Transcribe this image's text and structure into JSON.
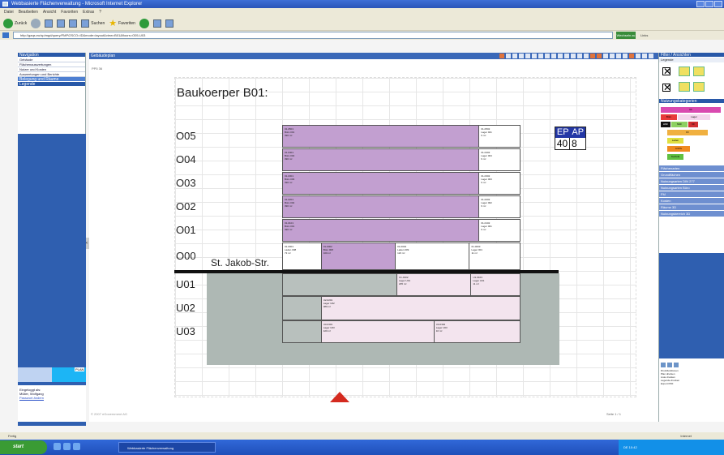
{
  "browser": {
    "title": "Webbasierte Flächenverwaltung - Microsoft Internet Explorer",
    "menu": [
      "Datei",
      "Bearbeiten",
      "Ansicht",
      "Favoriten",
      "Extras",
      "?"
    ],
    "back_label": "Zurück",
    "search_label": "Suchen",
    "favorites_label": "Favoriten",
    "address": "http://gaqs.eu/sp/mgd/query/FMP/2SCO=ID&mode=layout&view=B01&floors=O05-U03",
    "go_label": "Wechseln zu",
    "links_label": "Links"
  },
  "left_panel": {
    "header": "Navigation",
    "items": [
      "Gebäude",
      "Flächenauswertungen",
      "Nutzer und Kosten",
      "Auswertungen und Berichte",
      "Belegung und Räume",
      "Legende"
    ],
    "login_title": "Eingeloggt als:",
    "login_user": "Müller, Wolfgang",
    "login_link": "Passwort ändern",
    "mini_label": "PLAN"
  },
  "main": {
    "header": "Gebäudeplan",
    "sheet_id": "PP5 36",
    "building_title": "Baukoerper B01:",
    "street": "St. Jakob-Str.",
    "legend": {
      "ep": "EP",
      "ap": "AP",
      "ep_value": "40",
      "ap_value": "8"
    },
    "floors": [
      {
        "id": "O05",
        "cells": [
          {
            "kind": "office",
            "lines": [
              "01-0501",
              "Büro 001",
              "390 m²"
            ]
          },
          {
            "kind": "store",
            "lines": [
              "01-0502",
              "Lager 021",
              "9 m²"
            ]
          }
        ]
      },
      {
        "id": "O04",
        "cells": [
          {
            "kind": "office",
            "lines": [
              "01-0401",
              "Büro 004",
              "390 m²"
            ]
          },
          {
            "kind": "store",
            "lines": [
              "01-0402",
              "Lager 004",
              "9 m²"
            ]
          }
        ]
      },
      {
        "id": "O03",
        "cells": [
          {
            "kind": "office",
            "lines": [
              "01-0301",
              "Büro 003",
              "390 m²"
            ]
          },
          {
            "kind": "store",
            "lines": [
              "01-0302",
              "Lager 003",
              "9 m²"
            ]
          }
        ]
      },
      {
        "id": "O02",
        "cells": [
          {
            "kind": "office",
            "lines": [
              "01-0201",
              "Büro 002",
              "390 m²"
            ]
          },
          {
            "kind": "store",
            "lines": [
              "01-0202",
              "Lager 002",
              "9 m²"
            ]
          }
        ]
      },
      {
        "id": "O01",
        "cells": [
          {
            "kind": "office",
            "lines": [
              "01-0101",
              "Büro 001",
              "390 m²"
            ]
          },
          {
            "kind": "store",
            "lines": [
              "01-0102",
              "Lager 001",
              "9 m²"
            ]
          }
        ]
      },
      {
        "id": "O00",
        "cells": [
          {
            "kind": "store",
            "lines": [
              "01-0001",
              "Laden 008",
              "73 m²"
            ]
          },
          {
            "kind": "office",
            "lines": [
              "01-0002",
              "Büro 008",
              "100 m²"
            ]
          },
          {
            "kind": "store",
            "lines": [
              "01-0004",
              "Laden 009",
              "123 m²"
            ]
          },
          {
            "kind": "store",
            "lines": [
              "01-0003",
              "Lager 001",
              "11 m²"
            ]
          }
        ]
      },
      {
        "id": "U01",
        "cells": [
          {
            "kind": "grey",
            "lines": []
          },
          {
            "kind": "store-l",
            "lines": [
              "U1-0102",
              "Lager U01",
              "205 m²"
            ]
          },
          {
            "kind": "store-l",
            "lines": [
              "U1-0103",
              "Lager U01",
              "11 m²"
            ]
          }
        ]
      },
      {
        "id": "U02",
        "cells": [
          {
            "kind": "grey",
            "lines": []
          },
          {
            "kind": "store-l",
            "lines": [
              "U2-0201",
              "Lager U02",
              "380 m²"
            ]
          }
        ]
      },
      {
        "id": "U03",
        "cells": [
          {
            "kind": "grey",
            "lines": []
          },
          {
            "kind": "store-l",
            "lines": [
              "U3-0301",
              "Lager U03",
              "420 m²"
            ]
          },
          {
            "kind": "store-l",
            "lines": [
              "U3-0302",
              "Lager U03",
              "10 m²"
            ]
          }
        ]
      }
    ],
    "footer_left": "© 2007 eGovernment AG",
    "footer_right": "Seite 1 / 1"
  },
  "right_panel": {
    "header": "Filter / Ansichten",
    "legend_label": "Legende",
    "palette_label": "Nutzungskategorien",
    "palette": [
      "UF",
      "Büro",
      "Lager",
      "HNF",
      "NNF",
      "VF",
      "FF",
      "Laden",
      "Archiv",
      "Technik"
    ],
    "sections": [
      "Flächenarten",
      "Grundflächen",
      "Nutzungsarten DIN 277",
      "Nutzungsarten Büro",
      "FM",
      "Kosten",
      "Räume 3D",
      "Nutzungsbereich 3D"
    ],
    "small_title": "Druckfunktionen",
    "small_lines": [
      "Plan drucken",
      "Liste drucken",
      "Legende drucken",
      "Export PDF"
    ]
  },
  "status": {
    "left": "Fertig",
    "right": "Internet"
  },
  "taskbar": {
    "start": "start",
    "task": "Webbasierte Flächenverwaltung",
    "tray": "DE 10:42"
  }
}
